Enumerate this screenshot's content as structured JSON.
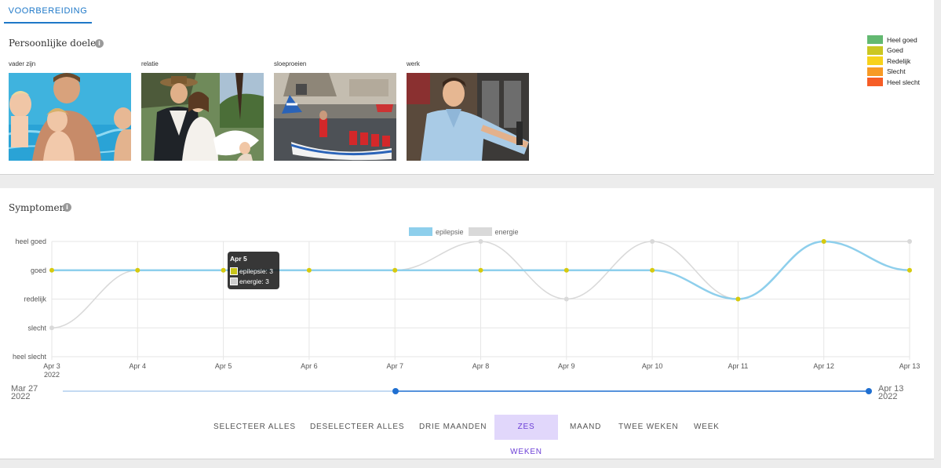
{
  "tabs": [
    {
      "label": "VOORBEREIDING",
      "active": true
    }
  ],
  "goals_section": {
    "title": "Persoonlijke doelen",
    "info_icon": "info-icon",
    "goals": [
      {
        "label": "vader zijn"
      },
      {
        "label": "relatie"
      },
      {
        "label": "sloeproeien"
      },
      {
        "label": "werk"
      }
    ],
    "rating_legend": [
      {
        "label": "Heel goed",
        "color": "#63b971"
      },
      {
        "label": "Goed",
        "color": "#cbc722"
      },
      {
        "label": "Redelijk",
        "color": "#f7d21b"
      },
      {
        "label": "Slecht",
        "color": "#f79a24"
      },
      {
        "label": "Heel slecht",
        "color": "#f65d26"
      }
    ]
  },
  "symptoms_section": {
    "title": "Symptomen",
    "info_icon": "info-icon",
    "tooltip": {
      "title": "Apr 5",
      "rows": [
        {
          "label": "epilepsie: 3",
          "color": "#c8c41b"
        },
        {
          "label": "energie: 3",
          "color": "#cccccc"
        }
      ]
    },
    "range": {
      "start_date": "Mar 27",
      "start_year": "2022",
      "end_date": "Apr 13",
      "end_year": "2022"
    },
    "buttons": [
      {
        "label": "SELECTEER ALLES",
        "active": false
      },
      {
        "label": "DESELECTEER ALLES",
        "active": false
      },
      {
        "label": "DRIE MAANDEN",
        "active": false
      },
      {
        "label": "ZES WEKEN",
        "active": true
      },
      {
        "label": "MAAND",
        "active": false
      },
      {
        "label": "TWEE WEKEN",
        "active": false
      },
      {
        "label": "WEEK",
        "active": false
      }
    ]
  },
  "chart_data": {
    "type": "line",
    "categories": [
      "Apr 3",
      "Apr 4",
      "Apr 5",
      "Apr 6",
      "Apr 7",
      "Apr 8",
      "Apr 9",
      "Apr 10",
      "Apr 11",
      "Apr 12",
      "Apr 13"
    ],
    "first_tick_year": "2022",
    "y_ticks": [
      "heel slecht",
      "slecht",
      "redelijk",
      "goed",
      "heel goed"
    ],
    "ylim": [
      0,
      4
    ],
    "grid": true,
    "legend_position": "top",
    "series": [
      {
        "name": "epilepsie",
        "color": "#8ecfec",
        "point_color": "#d6ca0e",
        "values": [
          3,
          3,
          3,
          3,
          3,
          3,
          3,
          3,
          2,
          4,
          3
        ]
      },
      {
        "name": "energie",
        "color": "#d9d9d9",
        "point_color": "#d9d9d9",
        "values": [
          1,
          3,
          3,
          3,
          3,
          4,
          2,
          4,
          2,
          4,
          4
        ]
      }
    ]
  }
}
